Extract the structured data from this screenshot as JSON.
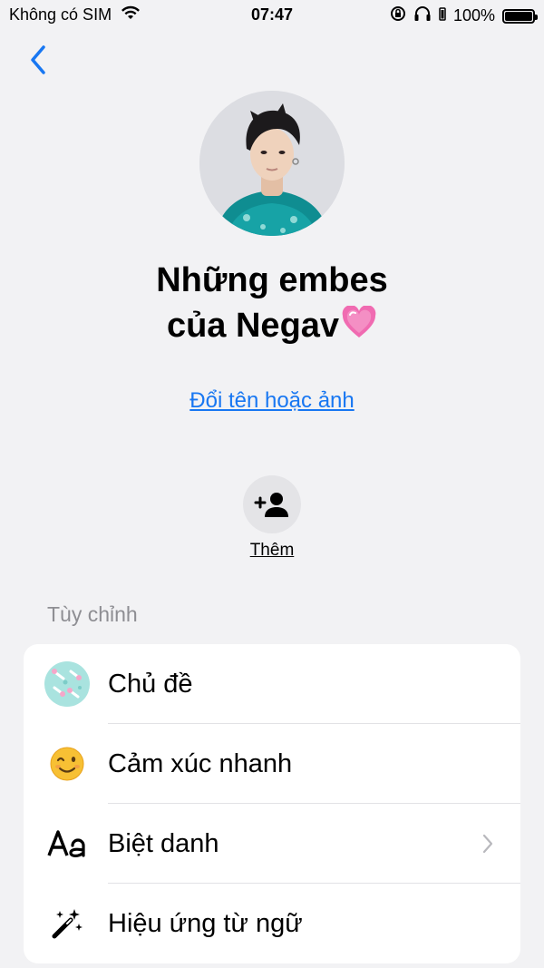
{
  "status_bar": {
    "carrier": "Không có SIM",
    "time": "07:47",
    "battery_percent": "100%"
  },
  "header": {
    "title_line1": "Những embes",
    "title_line2": "của Negav",
    "title_emoji": "💗",
    "rename_link": "Đổi tên hoặc ảnh"
  },
  "add_member": {
    "label": "Thêm"
  },
  "customize": {
    "section_title": "Tùy chỉnh",
    "items": [
      {
        "label": "Chủ đề",
        "icon": "theme-icon"
      },
      {
        "label": "Cảm xúc nhanh",
        "icon": "winking-emoji-icon"
      },
      {
        "label": "Biệt danh",
        "icon": "aa-text-icon"
      },
      {
        "label": "Hiệu ứng từ ngữ",
        "icon": "magic-wand-icon"
      }
    ]
  },
  "colors": {
    "accent": "#1877f2",
    "background": "#f2f2f4",
    "card": "#ffffff",
    "secondary_text": "#8e8e93"
  }
}
